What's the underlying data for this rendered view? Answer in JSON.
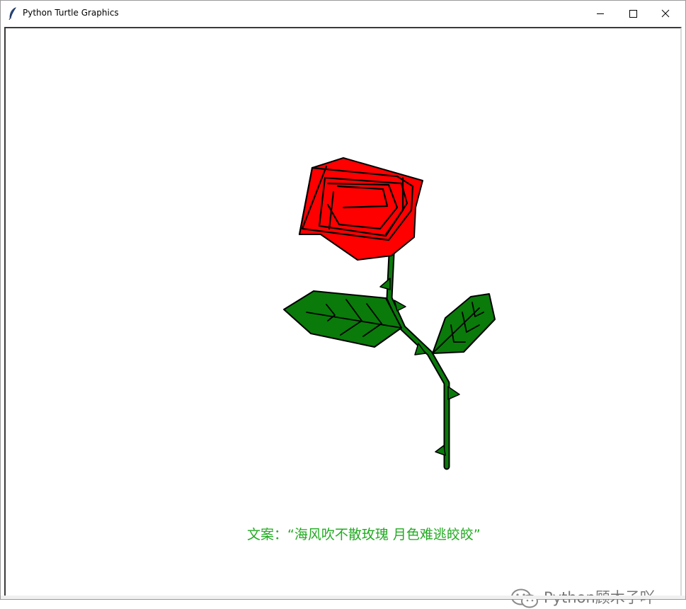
{
  "window": {
    "title": "Python Turtle Graphics",
    "icon": "feather-icon",
    "controls": [
      "minimize-icon",
      "maximize-icon",
      "close-icon"
    ]
  },
  "canvas": {
    "caption": "文案：“海风吹不散玫瑰 月色难逃皎皎”",
    "caption_color": "#22aa22",
    "drawing_subject": "rose",
    "colors": {
      "petal_fill": "#ff0000",
      "leaf_fill": "#008000",
      "outline": "#000000"
    }
  },
  "watermark": {
    "text": "Python顾木子吖",
    "icon": "wechat-icon"
  }
}
